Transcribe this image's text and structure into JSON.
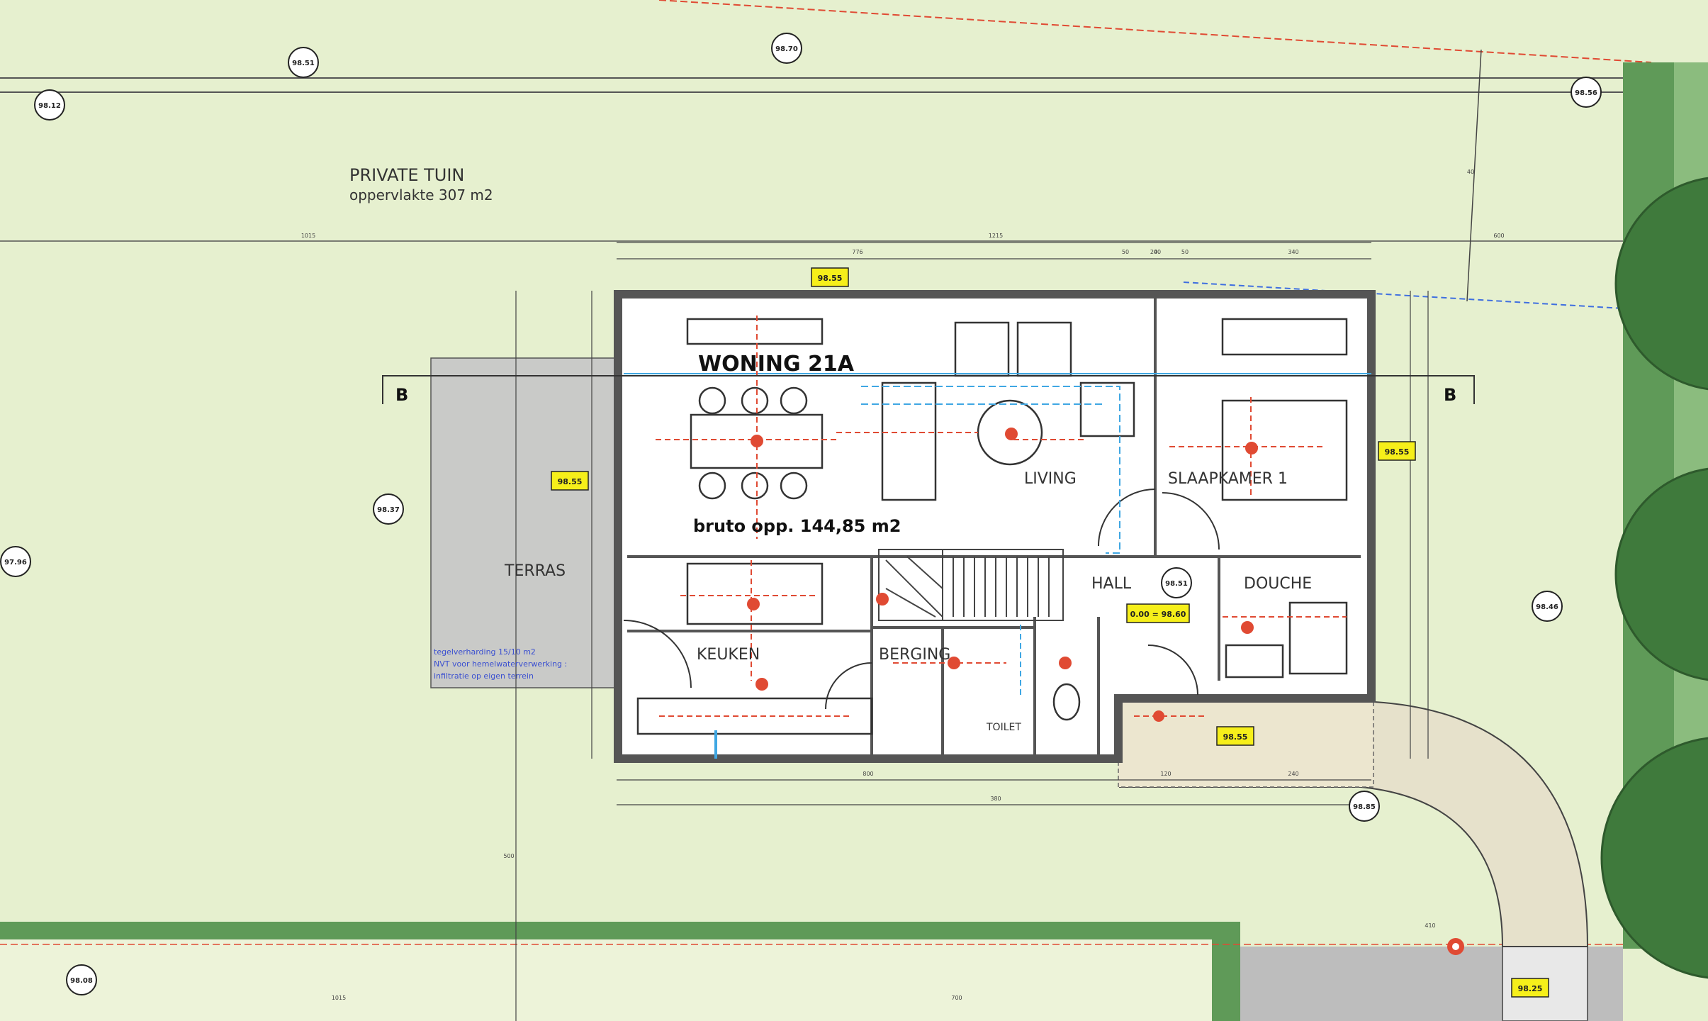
{
  "colors": {
    "lawn": "#e6f0cf",
    "hedge": "#5f9a58",
    "tree": "#3f7a3c",
    "terrace": "#c9cac8",
    "path": "#e6e1cb",
    "wall": "#555555",
    "floor": "#ffffff",
    "red": "#e04a33",
    "blue": "#3fa7e3",
    "tag": "#f6ef1a",
    "street": "#bdbdbd"
  },
  "garden": {
    "title": "PRIVATE TUIN",
    "area": "oppervlakte 307 m2"
  },
  "house": {
    "name": "WONING 21A",
    "gross_area": "bruto opp. 144,85 m2"
  },
  "section_markers": [
    {
      "label": "B",
      "side": "left"
    },
    {
      "label": "B",
      "side": "right"
    }
  ],
  "rooms": [
    {
      "label": "LIVING"
    },
    {
      "label": "SLAAPKAMER 1"
    },
    {
      "label": "TERRAS"
    },
    {
      "label": "HALL"
    },
    {
      "label": "DOUCHE"
    },
    {
      "label": "KEUKEN"
    },
    {
      "label": "BERGING"
    },
    {
      "label": "TOILET"
    }
  ],
  "level_tags": [
    {
      "value": "98.55"
    },
    {
      "value": "98.55"
    },
    {
      "value": "98.55"
    },
    {
      "value": "0.00 = 98.60"
    },
    {
      "value": "98.55"
    },
    {
      "value": "98.25"
    }
  ],
  "spot_heights": [
    {
      "value": "98.51"
    },
    {
      "value": "98.70"
    },
    {
      "value": "98.12"
    },
    {
      "value": "98.56"
    },
    {
      "value": "98.37"
    },
    {
      "value": "97.96"
    },
    {
      "value": "98.51"
    },
    {
      "value": "98.46"
    },
    {
      "value": "98.85"
    },
    {
      "value": "98.08"
    }
  ],
  "terrace_note": [
    "tegelverharding 15/10 m2",
    "NVT voor hemelwaterverwerking :",
    "infiltratie op eigen terrein"
  ],
  "dimensions": [
    {
      "value": "1015"
    },
    {
      "value": "776"
    },
    {
      "value": "50"
    },
    {
      "value": "20"
    },
    {
      "value": "40"
    },
    {
      "value": "50"
    },
    {
      "value": "340"
    },
    {
      "value": "1215"
    },
    {
      "value": "800"
    },
    {
      "value": "380"
    },
    {
      "value": "120"
    },
    {
      "value": "240"
    },
    {
      "value": "1015"
    },
    {
      "value": "700"
    },
    {
      "value": "410"
    },
    {
      "value": "600"
    },
    {
      "value": "40"
    },
    {
      "value": "500"
    }
  ]
}
